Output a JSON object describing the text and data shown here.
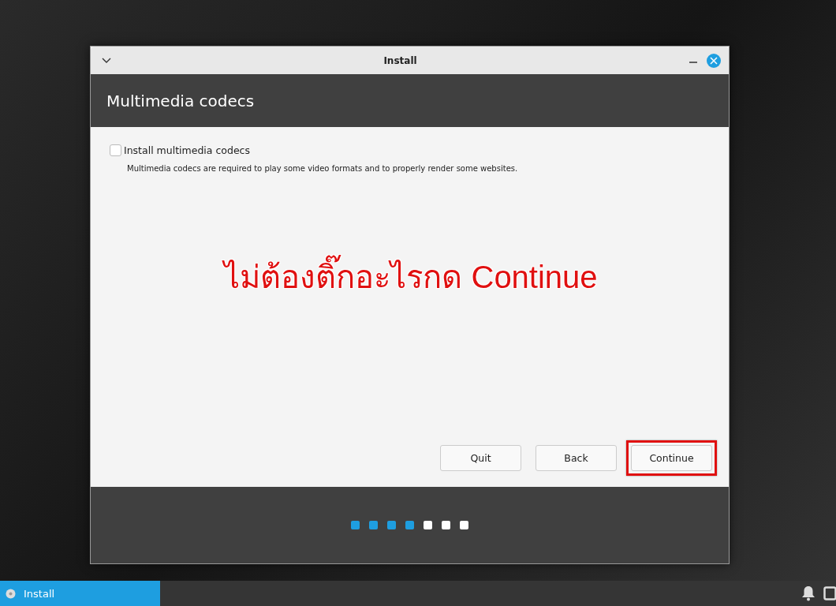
{
  "window": {
    "title": "Install"
  },
  "header": {
    "title": "Multimedia codecs"
  },
  "option": {
    "label": "Install multimedia codecs",
    "checked": false,
    "description": "Multimedia codecs are required to play some video formats and to properly render some websites."
  },
  "annotation": {
    "text": "ไม่ต้องติ๊กอะไรกด Continue"
  },
  "buttons": [
    {
      "label": "Quit",
      "highlighted": false
    },
    {
      "label": "Back",
      "highlighted": false
    },
    {
      "label": "Continue",
      "highlighted": true
    }
  ],
  "steps": [
    {
      "done": true
    },
    {
      "done": true
    },
    {
      "done": true
    },
    {
      "done": true
    },
    {
      "done": false
    },
    {
      "done": false
    },
    {
      "done": false
    }
  ],
  "taskbar": {
    "items": [
      {
        "label": "Install",
        "selected": true
      }
    ]
  }
}
